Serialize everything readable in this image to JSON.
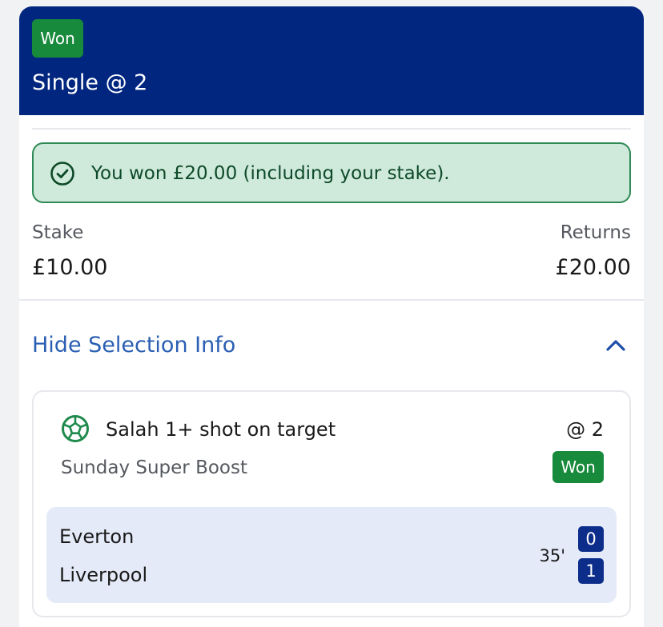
{
  "header": {
    "status_badge": "Won",
    "title": "Single @ 2",
    "background_color": "#00267f",
    "badge_color": "#178a3b"
  },
  "result": {
    "message": "You won £20.00 (including your stake).",
    "icon": "check-circle-icon"
  },
  "summary": {
    "stake_label": "Stake",
    "stake_value": "£10.00",
    "returns_label": "Returns",
    "returns_value": "£20.00"
  },
  "selection_toggle": {
    "label": "Hide Selection Info",
    "icon": "chevron-up-icon",
    "color": "#2a5fb3"
  },
  "selection": {
    "icon": "football-icon",
    "name": "Salah 1+ shot on target",
    "odds": "@ 2",
    "market": "Sunday Super Boost",
    "status_badge": "Won"
  },
  "match": {
    "home_team": "Everton",
    "away_team": "Liverpool",
    "time": "35'",
    "home_score": "0",
    "away_score": "1"
  }
}
